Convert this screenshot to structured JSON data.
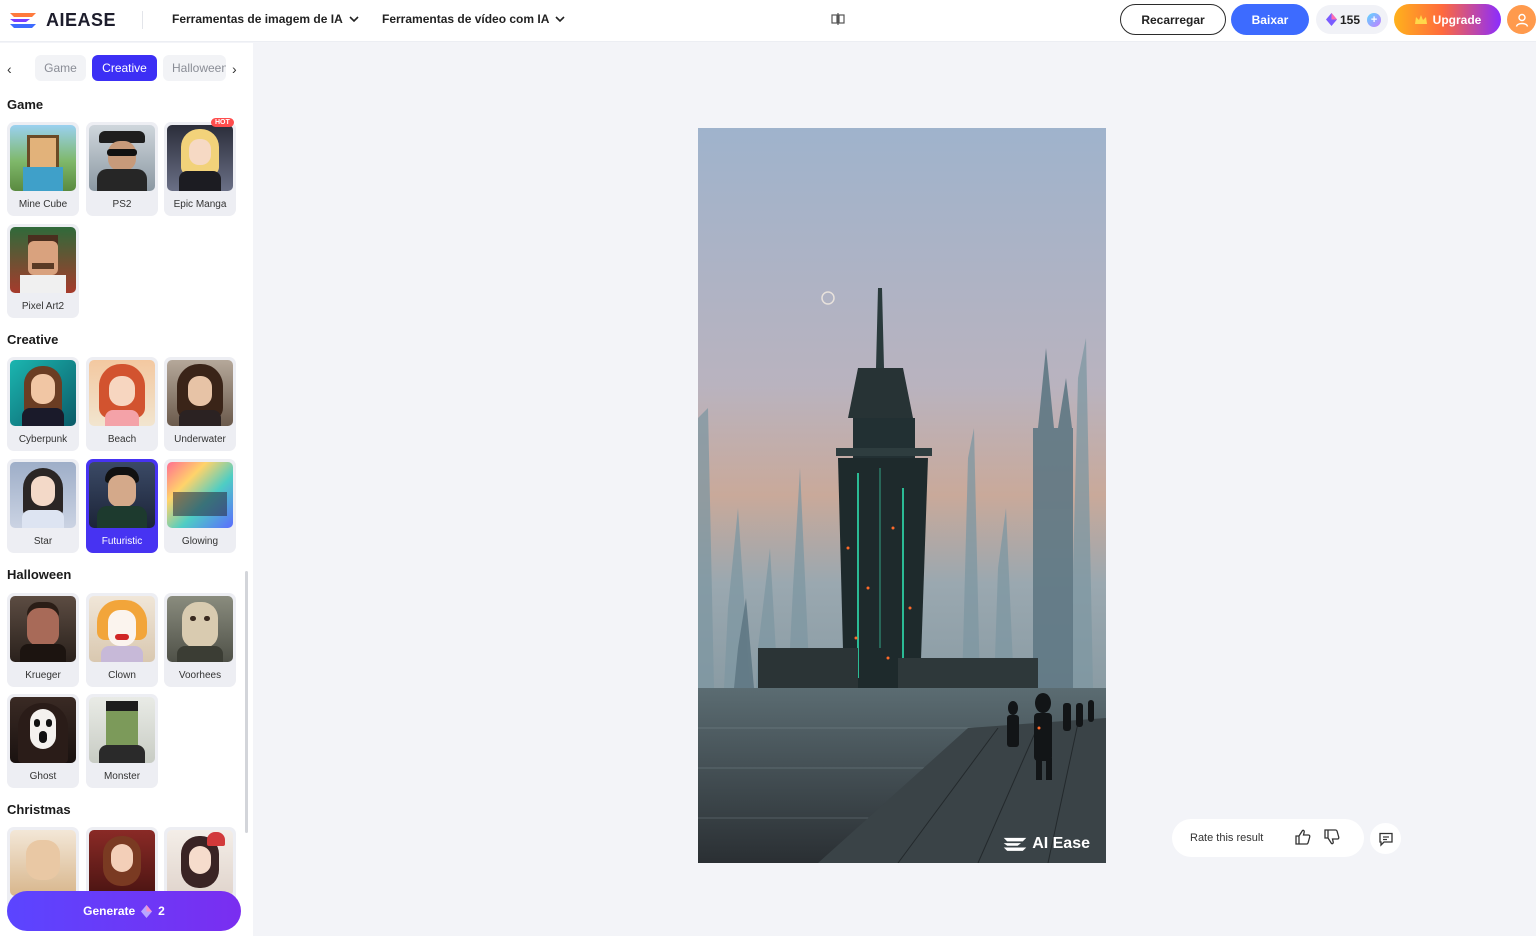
{
  "header": {
    "logo_text": "AIEASE",
    "menu_image_tools": "Ferramentas de imagem de IA",
    "menu_video_tools": "Ferramentas de vídeo com IA",
    "recharge_label": "Recarregar",
    "download_label": "Baixar",
    "credits": "155",
    "upgrade_label": "Upgrade"
  },
  "tabs": [
    "Game",
    "Creative",
    "Halloween"
  ],
  "active_tab": "Creative",
  "sections": [
    {
      "title": "Game",
      "items": [
        {
          "label": "Mine Cube",
          "hot": false
        },
        {
          "label": "PS2",
          "hot": false
        },
        {
          "label": "Epic Manga",
          "hot": true
        },
        {
          "label": "Pixel Art2",
          "hot": false
        }
      ]
    },
    {
      "title": "Creative",
      "items": [
        {
          "label": "Cyberpunk"
        },
        {
          "label": "Beach"
        },
        {
          "label": "Underwater"
        },
        {
          "label": "Star"
        },
        {
          "label": "Futuristic",
          "selected": true
        },
        {
          "label": "Glowing"
        }
      ]
    },
    {
      "title": "Halloween",
      "items": [
        {
          "label": "Krueger"
        },
        {
          "label": "Clown"
        },
        {
          "label": "Voorhees"
        },
        {
          "label": "Ghost"
        },
        {
          "label": "Monster"
        }
      ]
    },
    {
      "title": "Christmas",
      "items": []
    }
  ],
  "hot_badge": "HOT",
  "generate": {
    "label": "Generate",
    "cost": "2"
  },
  "result": {
    "watermark": "AI Ease"
  },
  "rating": {
    "label": "Rate this result"
  },
  "colors": {
    "accent": "#3c2ff5",
    "download": "#3d6bff",
    "selected_card": "#4733f2"
  }
}
